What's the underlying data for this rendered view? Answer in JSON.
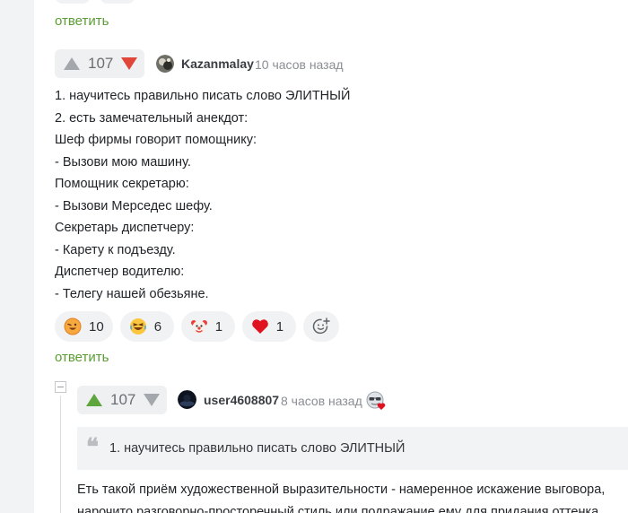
{
  "comment": {
    "reply_label": "ответить",
    "rating": {
      "value": "107",
      "vote": "down"
    },
    "author": "Kazanmalay",
    "time": "10 часов назад",
    "lines": [
      "1. научитесь правильно писать слово ЭЛИТНЫЙ",
      "2. есть замечательный анекдот:",
      "Шеф фирмы говорит помощнику:",
      "- Вызови мою машину.",
      "Помощник секретарю:",
      "- Вызови Мерседес шефу.",
      "Секретарь диспетчеру:",
      "- Карету к подъезду.",
      "Диспетчер водителю:",
      "- Телегу нашей обезьяне."
    ],
    "reactions": [
      {
        "icon": "grinning-face-emoji-icon",
        "count": "10"
      },
      {
        "icon": "laughing-face-emoji-icon",
        "count": "6"
      },
      {
        "icon": "clown-face-emoji-icon",
        "count": "1"
      },
      {
        "icon": "red-heart-icon",
        "count": "1"
      }
    ],
    "reply_label_bottom": "ответить"
  },
  "reply": {
    "rating": {
      "value": "107",
      "vote": "up"
    },
    "author": "user4608807",
    "time": "8 часов назад",
    "quote": "1. научитесь правильно писать слово ЭЛИТНЫЙ",
    "lines": [
      "Еть такой приём художественной выразительности - намеренное искажение выговора,",
      "нарочито разговорно-просторечный стиль или подражание ему для придания оттенка"
    ]
  },
  "colors": {
    "accent_green": "#5b9c33",
    "upvote_green": "#5da53c",
    "downvote_red": "#e0463a",
    "neutral_gray": "#a4a7ab"
  }
}
